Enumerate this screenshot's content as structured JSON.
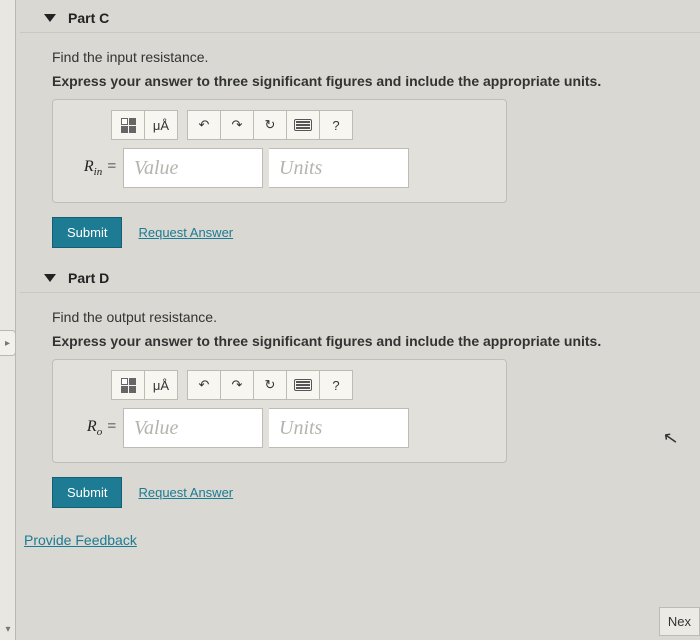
{
  "parts": [
    {
      "id": "C",
      "title": "Part C",
      "prompt": "Find the input resistance.",
      "instruction": "Express your answer to three significant figures and include the appropriate units.",
      "var_html": "R<sub>in</sub> =",
      "value_placeholder": "Value",
      "units_placeholder": "Units",
      "submit_label": "Submit",
      "request_label": "Request Answer"
    },
    {
      "id": "D",
      "title": "Part D",
      "prompt": "Find the output resistance.",
      "instruction": "Express your answer to three significant figures and include the appropriate units.",
      "var_html": "R<sub>o</sub> =",
      "value_placeholder": "Value",
      "units_placeholder": "Units",
      "submit_label": "Submit",
      "request_label": "Request Answer"
    }
  ],
  "toolbar": {
    "templates_tip": "templates",
    "symbols_label": "μÅ",
    "undo_tip": "undo",
    "redo_tip": "redo",
    "reset_tip": "reset",
    "keyboard_tip": "keyboard",
    "help_label": "?"
  },
  "feedback_label": "Provide Feedback",
  "next_label": "Nex"
}
